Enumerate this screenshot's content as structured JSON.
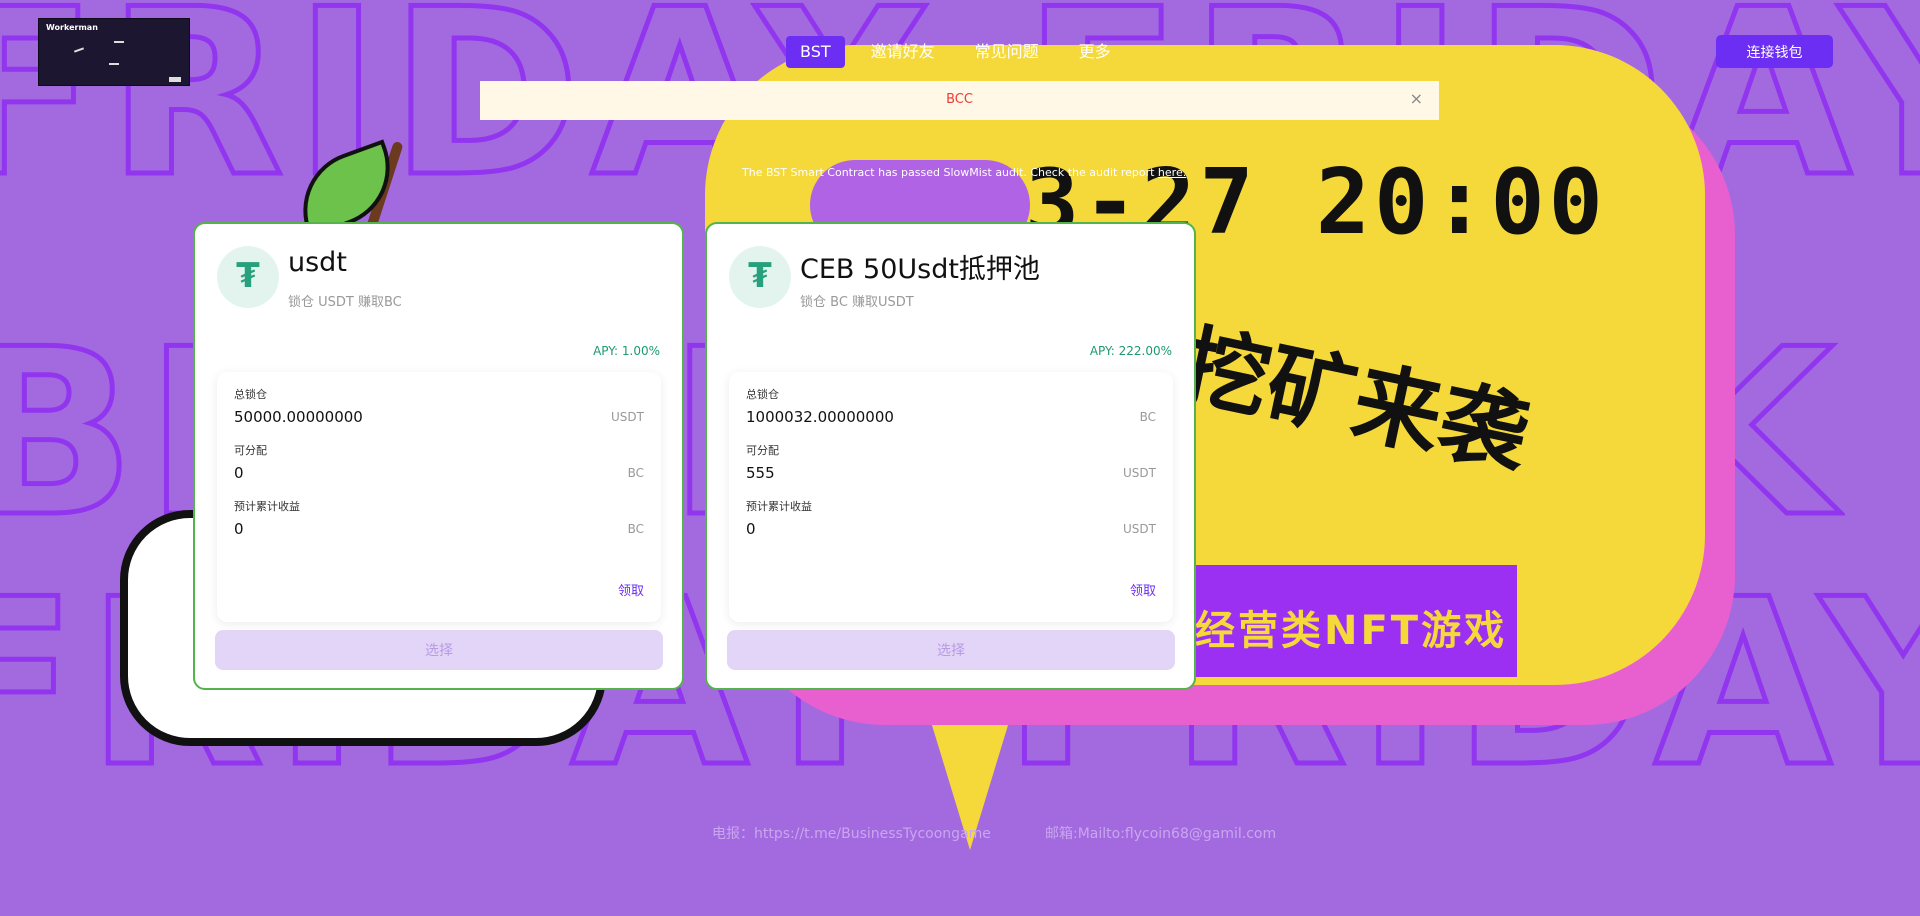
{
  "header": {
    "logo_text": "Workerman",
    "nav": [
      {
        "label": "BST",
        "active": true
      },
      {
        "label": "邀请好友",
        "active": false
      },
      {
        "label": "常见问题",
        "active": false
      },
      {
        "label": "更多",
        "active": false
      }
    ],
    "connect_label": "连接钱包"
  },
  "notice": {
    "text": "BCC",
    "close_glyph": "×"
  },
  "audit": {
    "text": "The BST Smart Contract has passed SlowMist audit. Check the audit report ",
    "link": "here."
  },
  "banner": {
    "date": "3-27 20:00",
    "mining": "挖矿来袭",
    "nft": "经营类NFT游戏"
  },
  "pools": [
    {
      "icon": "tether-icon",
      "title": "usdt",
      "subtitle": "锁仓 USDT 赚取BC",
      "apy": "APY: 1.00%",
      "stats": [
        {
          "label": "总锁仓",
          "value": "50000.00000000",
          "unit": "USDT"
        },
        {
          "label": "可分配",
          "value": "0",
          "unit": "BC"
        },
        {
          "label": "预计累计收益",
          "value": "0",
          "unit": "BC"
        }
      ],
      "claim_label": "领取",
      "select_label": "选择"
    },
    {
      "icon": "tether-icon",
      "title": "CEB 50Usdt抵押池",
      "subtitle": "锁仓 BC 赚取USDT",
      "apy": "APY: 222.00%",
      "stats": [
        {
          "label": "总锁仓",
          "value": "1000032.00000000",
          "unit": "BC"
        },
        {
          "label": "可分配",
          "value": "555",
          "unit": "USDT"
        },
        {
          "label": "预计累计收益",
          "value": "0",
          "unit": "USDT"
        }
      ],
      "claim_label": "领取",
      "select_label": "选择"
    }
  ],
  "footer": {
    "telegram": "电报：https://t.me/BusinessTycoongame",
    "email": "邮箱:Mailto:flycoin68@gamil.com"
  },
  "colors": {
    "background": "#a36ae0",
    "accent": "#6c2ef2",
    "apy": "#1e9a6e",
    "card_border": "#54b34a"
  }
}
